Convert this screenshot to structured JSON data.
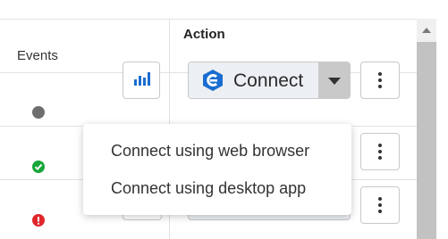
{
  "columns": {
    "events": "Events",
    "action": "Action"
  },
  "rows": [
    {
      "status_icon": "gray-dot-icon",
      "status_color": "#6e6e6e"
    },
    {
      "status_icon": "green-check-icon",
      "status_color": "#18a53a"
    },
    {
      "status_icon": "red-exclamation-icon",
      "status_color": "#e0262b"
    }
  ],
  "connect": {
    "label": "Connect",
    "icon": "connect-brand-icon",
    "icon_color": "#1a6dd0"
  },
  "dropdown": {
    "items": [
      "Connect using web browser",
      "Connect using desktop app"
    ]
  },
  "colors": {
    "accent": "#1a6dd0",
    "button_bg": "#eceff3",
    "caret_bg": "#c9c9c9"
  }
}
